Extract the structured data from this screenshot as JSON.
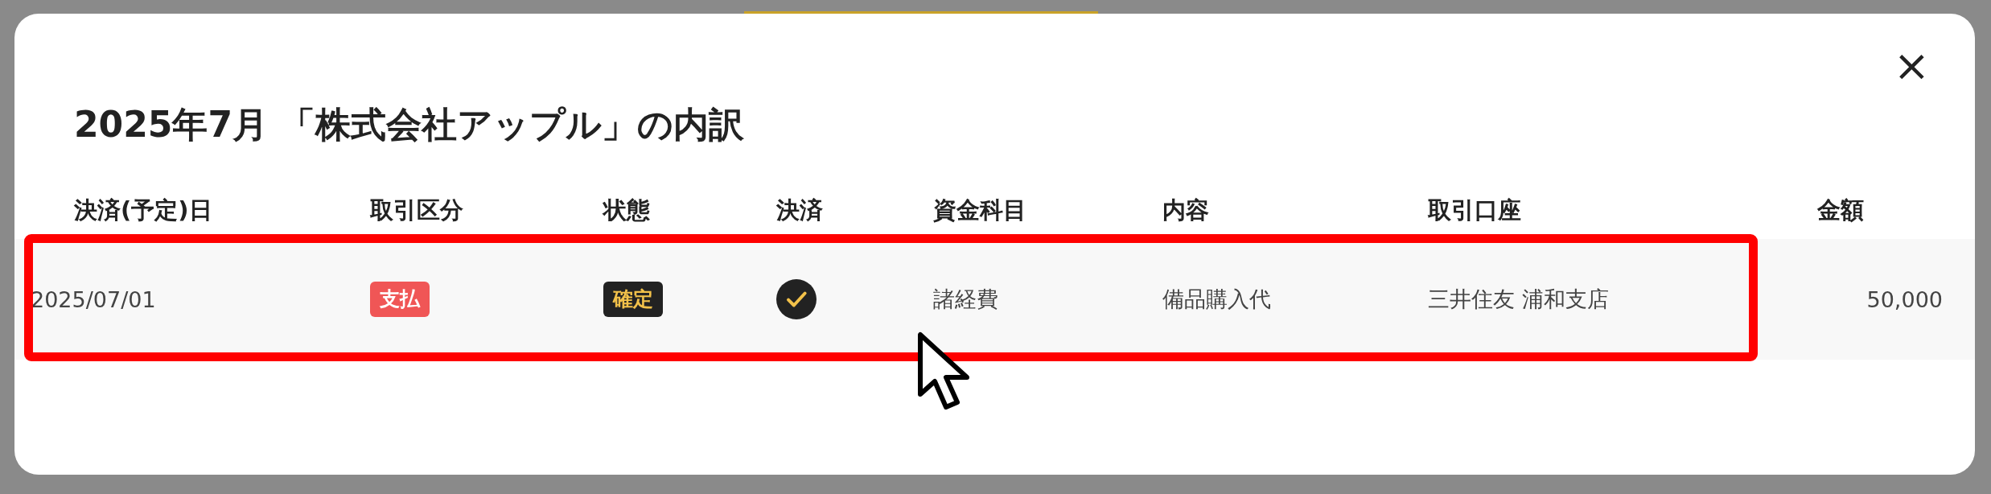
{
  "dialog": {
    "title": "2025年7月 「株式会社アップル」の内訳",
    "close": "×"
  },
  "table": {
    "columns": [
      "決済(予定)日",
      "取引区分",
      "状態",
      "決済",
      "資金科目",
      "内容",
      "取引口座",
      "金額"
    ],
    "rows": [
      {
        "date": "2025/07/01",
        "type": {
          "label": "支払",
          "kind": "payment"
        },
        "status": {
          "label": "確定",
          "kind": "confirmed"
        },
        "settled": true,
        "account": "諸経費",
        "content": "備品購入代",
        "bank": "三井住友 浦和支店",
        "amount": "50,000",
        "highlighted": true
      }
    ]
  }
}
